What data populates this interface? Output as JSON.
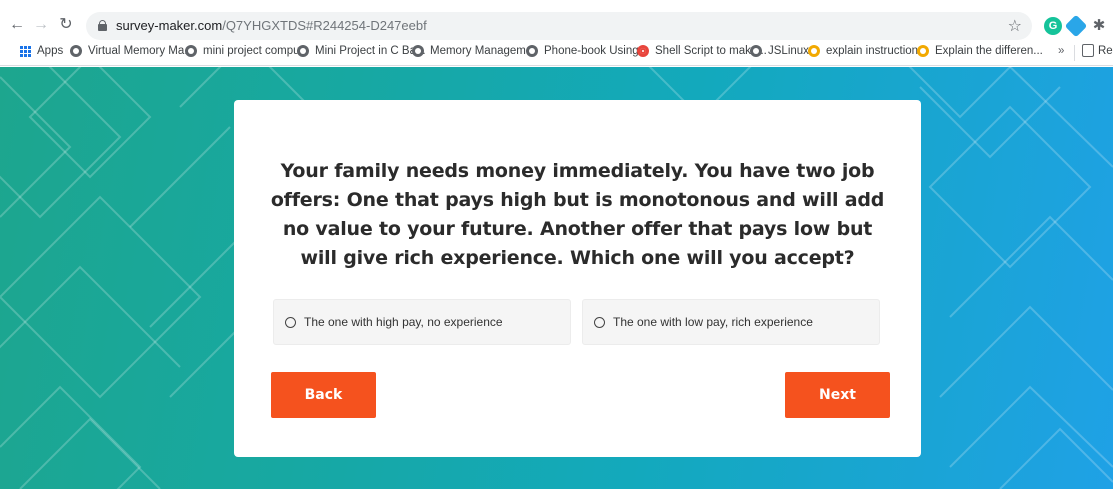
{
  "browser": {
    "url_host": "survey-maker.com",
    "url_path": "/Q7YHGXTDS#R244254-D247eebf",
    "bookmarks": [
      {
        "label": "Apps",
        "icon": "apps-icon"
      },
      {
        "label": "Virtual Memory Ma...",
        "icon": "globe-icon"
      },
      {
        "label": "mini project compu...",
        "icon": "globe-icon"
      },
      {
        "label": "Mini Project in C Ba...",
        "icon": "globe-icon"
      },
      {
        "label": "Memory Managem...",
        "icon": "globe-icon"
      },
      {
        "label": "Phone-book Using...",
        "icon": "globe-icon"
      },
      {
        "label": "Shell Script to make...",
        "icon": "target-icon"
      },
      {
        "label": "JSLinux",
        "icon": "globe-icon"
      },
      {
        "label": "explain instruction...",
        "icon": "quora-icon"
      },
      {
        "label": "Explain the differen...",
        "icon": "quora-icon"
      }
    ],
    "more": "»",
    "reading_list": "Re"
  },
  "survey": {
    "question": "Your family needs money immediately. You have two job offers: One that pays high but is monotonous and will add no value to your future. Another offer that pays low but will give rich experience. Which one will you accept?",
    "options": [
      {
        "label": "The one with high pay, no experience",
        "selected": false
      },
      {
        "label": "The one with low pay, rich experience",
        "selected": false
      }
    ],
    "back_label": "Back",
    "next_label": "Next"
  },
  "colors": {
    "accent_button": "#f5521e",
    "background_start": "#1da68e",
    "background_end": "#1fa1e6"
  }
}
